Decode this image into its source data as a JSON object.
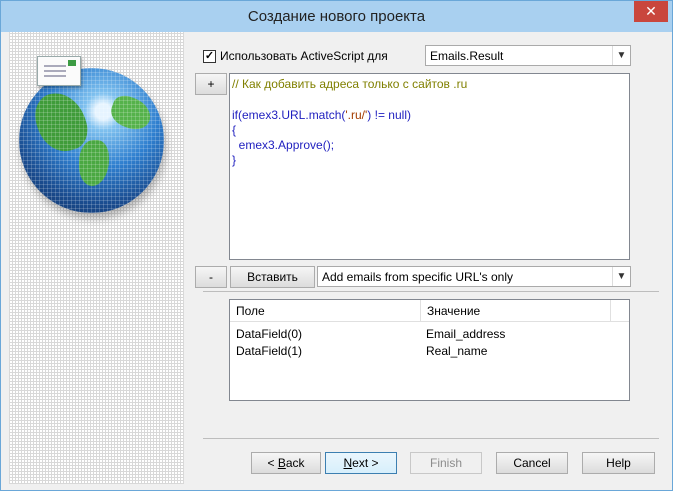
{
  "window": {
    "title": "Создание нового проекта",
    "close_glyph": "✕"
  },
  "options": {
    "checkbox_checked": true,
    "checkbox_glyph": "✓",
    "checkbox_label": "Использовать ActiveScript для",
    "target_value": "Emails.Result"
  },
  "editor": {
    "lines": [
      "// Как добавить адреса только с сайтов .ru",
      "",
      "",
      "if(emex3.URL.match('.ru/') != null)",
      "{",
      "  emex3.Approve();",
      "}"
    ],
    "string_literal": "'.ru/'"
  },
  "toolbar": {
    "add_label": "+",
    "remove_label": "-",
    "insert_label": "Вставить",
    "template_value": "Add emails from specific URL's only"
  },
  "table": {
    "columns": [
      "Поле",
      "Значение"
    ],
    "rows": [
      [
        "DataField(0)",
        "Email_address"
      ],
      [
        "DataField(1)",
        "Real_name"
      ]
    ]
  },
  "footer": {
    "back_prefix": "< ",
    "back_mnemonic": "B",
    "back_rest": "ack",
    "next_mnemonic": "N",
    "next_rest": "ext >",
    "finish_label": "Finish",
    "cancel_label": "Cancel",
    "help_label": "Help"
  },
  "icons": {
    "dropdown": "chevron-down-icon",
    "globe": "globe-icon",
    "envelope": "envelope-icon"
  }
}
